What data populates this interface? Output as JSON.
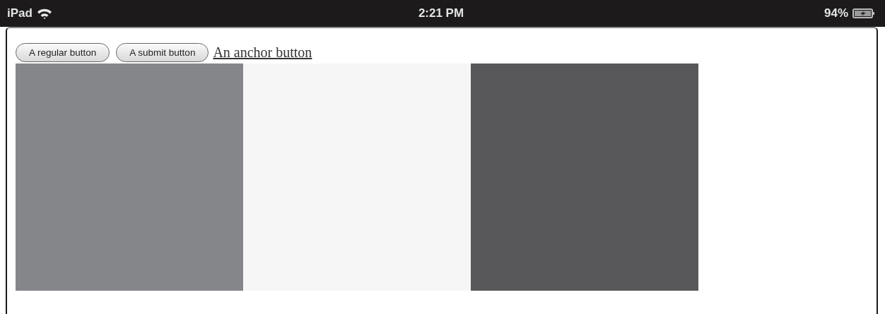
{
  "status_bar": {
    "device": "iPad",
    "time": "2:21 PM",
    "battery": "94%"
  },
  "buttons": [
    {
      "label": "A regular button",
      "kind": "button"
    },
    {
      "label": "A submit button",
      "kind": "button"
    },
    {
      "label": "An anchor button",
      "kind": "link"
    }
  ],
  "boxes": [
    {
      "color": "#858689"
    },
    {
      "color": "#f6f6f6"
    },
    {
      "color": "#58585a"
    }
  ]
}
